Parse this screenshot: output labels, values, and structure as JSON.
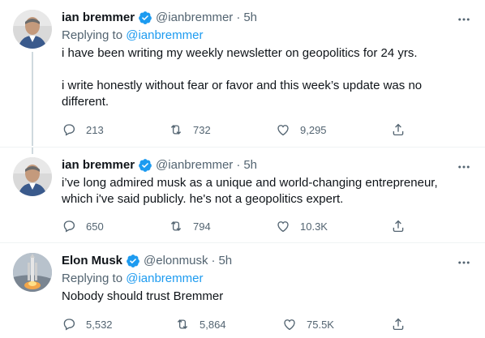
{
  "tweets": [
    {
      "name": "ian bremmer",
      "handle": "@ianbremmer",
      "time": "5h",
      "reply_prefix": "Replying to",
      "reply_handle": "@ianbremmer",
      "paragraphs": [
        "i have been writing my weekly newsletter on geopolitics for 24 yrs.",
        "i write honestly without fear or favor and this week’s update was no different."
      ],
      "replies": "213",
      "retweets": "732",
      "likes": "9,295",
      "verified_color": "#1d9bf0"
    },
    {
      "name": "ian bremmer",
      "handle": "@ianbremmer",
      "time": "5h",
      "paragraphs": [
        "i’ve long admired musk as a unique and world-changing entrepreneur, which i've said publicly. he's not a geopolitics expert."
      ],
      "replies": "650",
      "retweets": "794",
      "likes": "10.3K",
      "verified_color": "#1d9bf0"
    },
    {
      "name": "Elon Musk",
      "handle": "@elonmusk",
      "time": "5h",
      "reply_prefix": "Replying to",
      "reply_handle": "@ianbremmer",
      "paragraphs": [
        "Nobody should trust Bremmer"
      ],
      "replies": "5,532",
      "retweets": "5,864",
      "likes": "75.5K",
      "verified_color": "#1d9bf0"
    }
  ],
  "separator": "·",
  "more_glyph": "···",
  "icons": {
    "reply": "reply-icon",
    "retweet": "retweet-icon",
    "like": "heart-icon",
    "share": "share-icon",
    "more": "more-icon",
    "verified": "verified-badge-icon"
  }
}
